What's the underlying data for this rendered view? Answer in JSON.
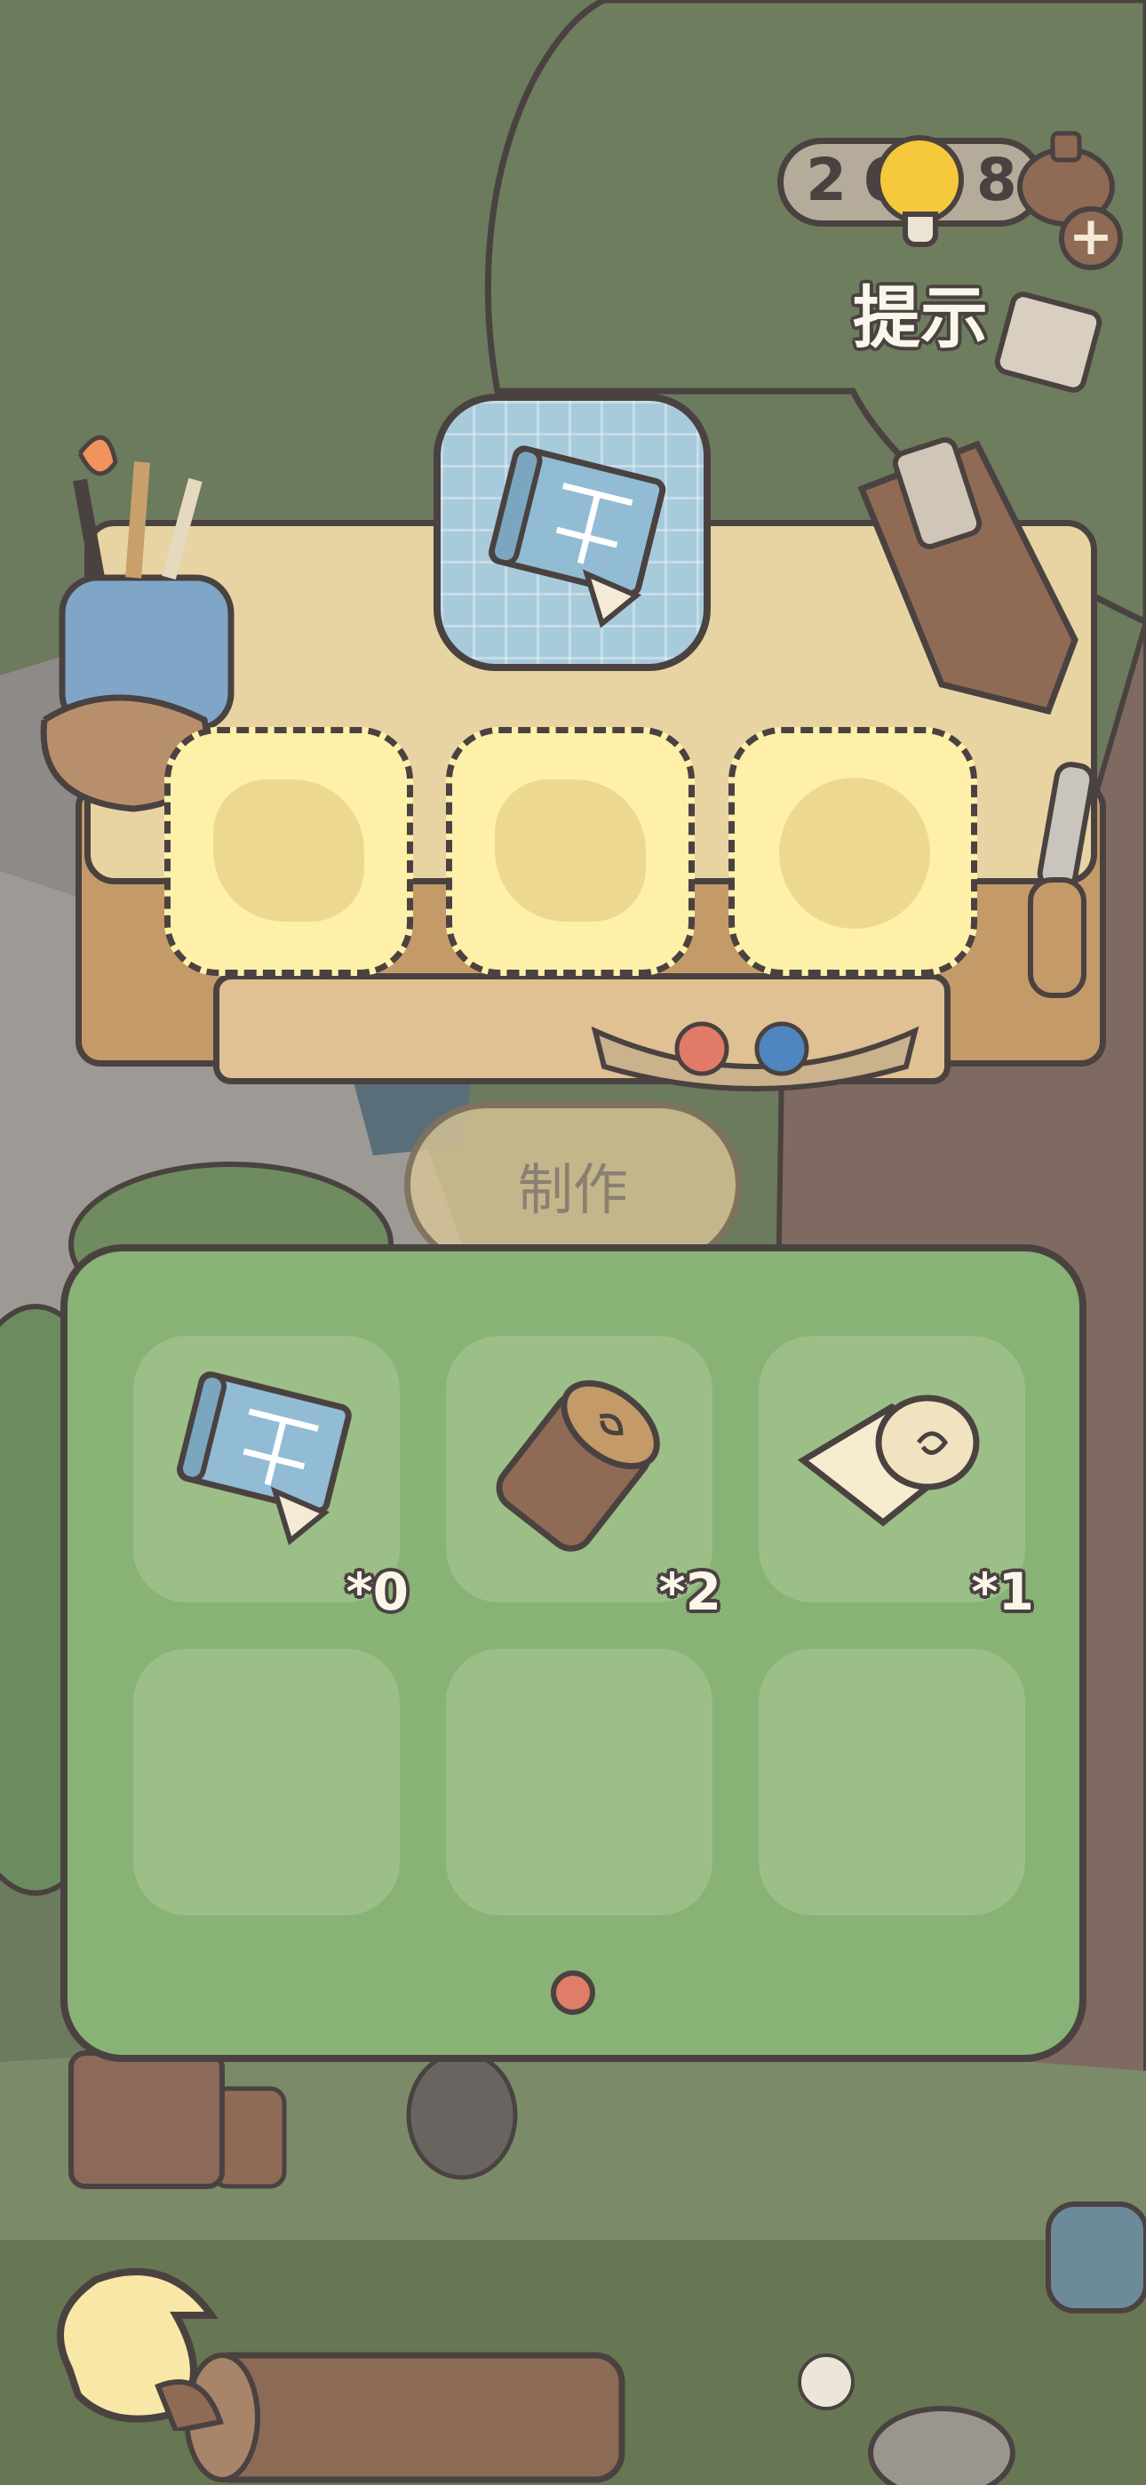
{
  "hint": {
    "count": "2698",
    "label": "提示",
    "plus_icon": "+"
  },
  "workbench": {
    "recipe_icon": "blueprint-icon",
    "slots": [
      {
        "ghost": "log-silhouette"
      },
      {
        "ghost": "log-silhouette"
      },
      {
        "ghost": "roll-silhouette"
      }
    ]
  },
  "craft_button": {
    "label": "制作",
    "enabled": false
  },
  "inventory": {
    "items": [
      {
        "icon": "blueprint-icon",
        "quantity": "*0"
      },
      {
        "icon": "wood-log-icon",
        "quantity": "*2"
      },
      {
        "icon": "paper-roll-icon",
        "quantity": "*1"
      }
    ],
    "empty_slots": 3,
    "page": 1
  },
  "colors": {
    "outline": "#4a4240",
    "panel_green": "#89b276",
    "slot_yellow": "#fff0a9",
    "bulb_yellow": "#f5c93b",
    "page_dot": "#e07d68"
  }
}
